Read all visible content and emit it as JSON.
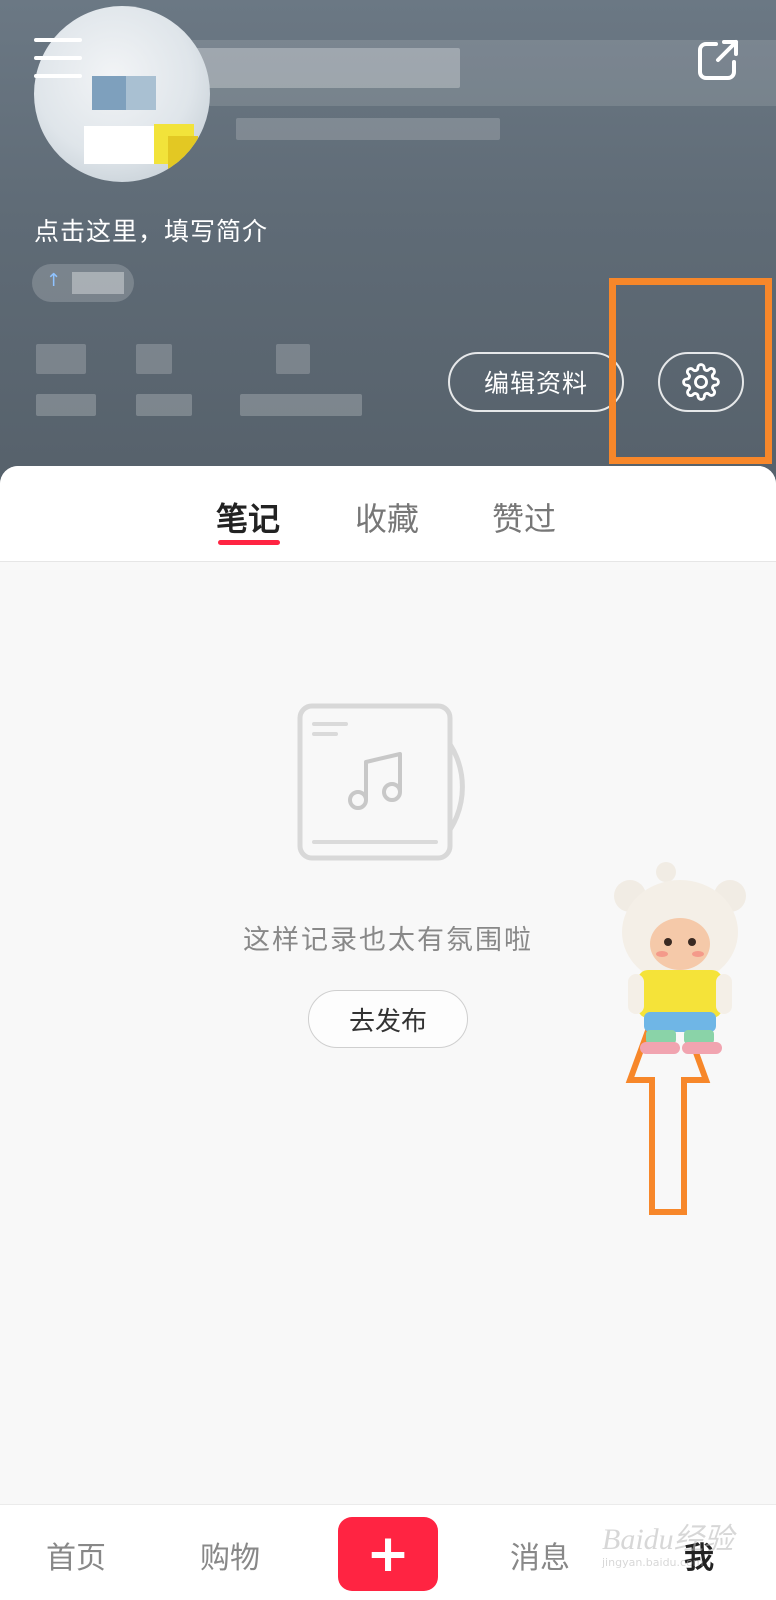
{
  "header": {
    "bio_placeholder": "点击这里，填写简介",
    "edit_profile_label": "编辑资料"
  },
  "tabs": [
    {
      "label": "笔记",
      "active": true
    },
    {
      "label": "收藏",
      "active": false
    },
    {
      "label": "赞过",
      "active": false
    }
  ],
  "empty_state": {
    "message": "这样记录也太有氛围啦",
    "publish_label": "去发布"
  },
  "bottom_nav": {
    "items": [
      {
        "label": "首页",
        "active": false
      },
      {
        "label": "购物",
        "active": false
      },
      {
        "label": "+",
        "active": false
      },
      {
        "label": "消息",
        "active": false
      },
      {
        "label": "我",
        "active": true
      }
    ]
  },
  "watermark": {
    "text": "Baidu经验",
    "sub": "jingyan.baidu.com"
  },
  "colors": {
    "accent": "#ff2442",
    "annotation": "#f7872a",
    "header_bg": "#5f6b76"
  }
}
